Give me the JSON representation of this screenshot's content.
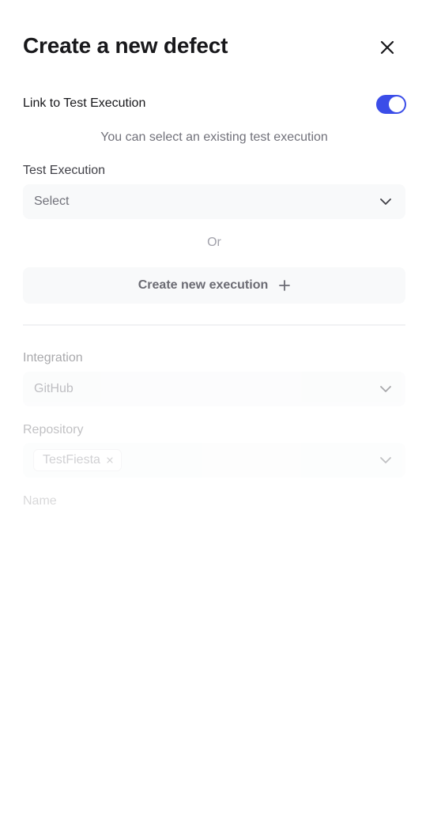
{
  "header": {
    "title": "Create a new defect"
  },
  "link_toggle": {
    "label": "Link to Test Execution",
    "enabled": true,
    "hint": "You can select an existing test execution"
  },
  "test_execution": {
    "label": "Test Execution",
    "placeholder": "Select"
  },
  "divider_text": "Or",
  "create_execution": {
    "label": "Create new execution"
  },
  "integration": {
    "label": "Integration",
    "value": "GitHub"
  },
  "repository": {
    "label": "Repository",
    "selected_chip": "TestFiesta"
  },
  "name": {
    "label": "Name"
  },
  "colors": {
    "accent": "#3b4de8",
    "field_bg": "#f8f9fa"
  },
  "icons": {
    "close": "close-icon",
    "chevron": "chevron-down-icon",
    "plus": "plus-icon",
    "chip_remove": "chip-remove-icon"
  }
}
